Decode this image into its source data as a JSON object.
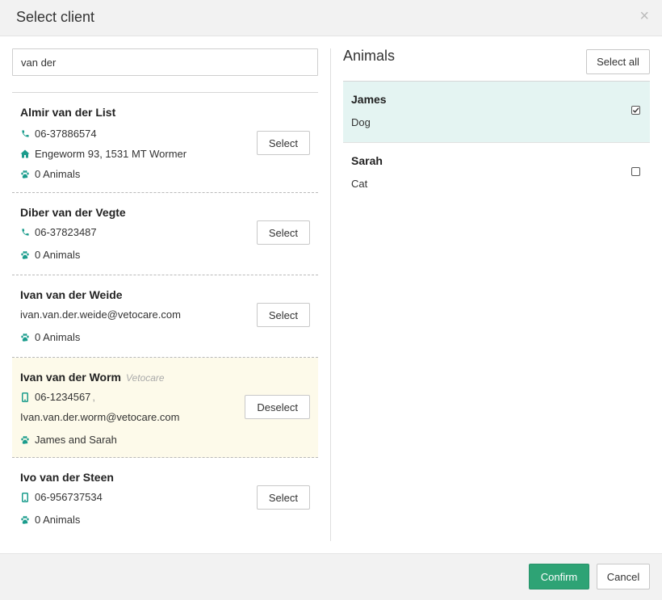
{
  "modal": {
    "title": "Select client",
    "close_glyph": "×"
  },
  "search": {
    "value": "van der"
  },
  "clients": [
    {
      "name": "Almir van der List",
      "phone": "06-37886574",
      "address": "Engeworm 93, 1531 MT Wormer",
      "animals": "0 Animals",
      "button": "Select"
    },
    {
      "name": "Diber van der Vegte",
      "phone": "06-37823487",
      "animals": "0 Animals",
      "button": "Select"
    },
    {
      "name": "Ivan van der Weide",
      "email": "ivan.van.der.weide@vetocare.com",
      "animals": "0 Animals",
      "button": "Select"
    },
    {
      "name": "Ivan van der Worm",
      "tag": "Vetocare",
      "mobile": "06-1234567",
      "separator": ",",
      "email": "Ivan.van.der.worm@vetocare.com",
      "animals": "James and Sarah",
      "button": "Deselect"
    },
    {
      "name": "Ivo van der Steen",
      "mobile": "06-956737534",
      "animals": "0 Animals",
      "button": "Select"
    }
  ],
  "animals_panel": {
    "title": "Animals",
    "select_all_label": "Select all",
    "items": [
      {
        "name": "James",
        "species": "Dog",
        "checked": true
      },
      {
        "name": "Sarah",
        "species": "Cat",
        "checked": false
      }
    ]
  },
  "footer": {
    "confirm_label": "Confirm",
    "cancel_label": "Cancel"
  },
  "colors": {
    "accent": "#2ea375",
    "icon": "#1a9c8c",
    "selected_client_bg": "#fdfaea",
    "selected_animal_bg": "#e4f4f2"
  },
  "icons": {
    "phone": "phone-icon",
    "address": "home-icon",
    "animals": "paw-icon",
    "mobile": "mobile-icon",
    "checked": "checkbox-checked-icon",
    "unchecked": "checkbox-empty-icon",
    "close": "close-icon"
  }
}
